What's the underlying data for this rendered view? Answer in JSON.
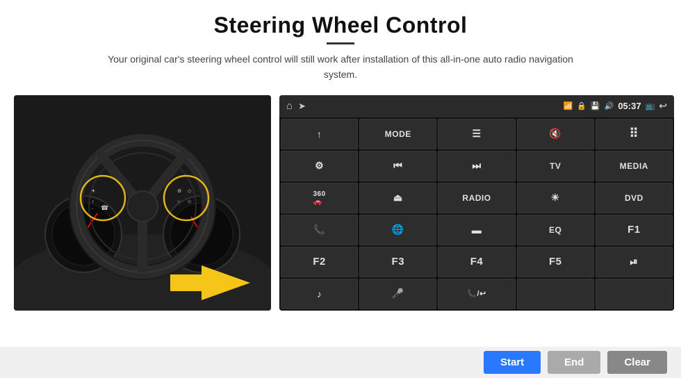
{
  "header": {
    "title": "Steering Wheel Control",
    "subtitle": "Your original car's steering wheel control will still work after installation of this all-in-one auto radio navigation system."
  },
  "android_panel": {
    "status_bar": {
      "time": "05:37",
      "icons": [
        "wifi",
        "lock",
        "sd",
        "bluetooth",
        "cast",
        "back"
      ]
    },
    "grid_buttons": [
      {
        "id": "row1-col1",
        "label": "↑",
        "icon": true
      },
      {
        "id": "row1-col2",
        "label": "MODE",
        "icon": false
      },
      {
        "id": "row1-col3",
        "label": "≡",
        "icon": true
      },
      {
        "id": "row1-col4",
        "label": "🔇",
        "icon": true
      },
      {
        "id": "row1-col5",
        "label": "⊞",
        "icon": true
      },
      {
        "id": "row2-col1",
        "label": "⚙",
        "icon": true
      },
      {
        "id": "row2-col2",
        "label": "⏮",
        "icon": true
      },
      {
        "id": "row2-col3",
        "label": "⏭",
        "icon": true
      },
      {
        "id": "row2-col4",
        "label": "TV",
        "icon": false
      },
      {
        "id": "row2-col5",
        "label": "MEDIA",
        "icon": false
      },
      {
        "id": "row3-col1",
        "label": "360",
        "icon": false
      },
      {
        "id": "row3-col2",
        "label": "⏏",
        "icon": true
      },
      {
        "id": "row3-col3",
        "label": "RADIO",
        "icon": false
      },
      {
        "id": "row3-col4",
        "label": "☀",
        "icon": true
      },
      {
        "id": "row3-col5",
        "label": "DVD",
        "icon": false
      },
      {
        "id": "row4-col1",
        "label": "📞",
        "icon": true
      },
      {
        "id": "row4-col2",
        "label": "🌐",
        "icon": true
      },
      {
        "id": "row4-col3",
        "label": "▬",
        "icon": true
      },
      {
        "id": "row4-col4",
        "label": "EQ",
        "icon": false
      },
      {
        "id": "row4-col5",
        "label": "F1",
        "icon": false
      },
      {
        "id": "row5-col1",
        "label": "F2",
        "icon": false
      },
      {
        "id": "row5-col2",
        "label": "F3",
        "icon": false
      },
      {
        "id": "row5-col3",
        "label": "F4",
        "icon": false
      },
      {
        "id": "row5-col4",
        "label": "F5",
        "icon": false
      },
      {
        "id": "row5-col5",
        "label": "⏯",
        "icon": true
      },
      {
        "id": "row6-col1",
        "label": "♪",
        "icon": true
      },
      {
        "id": "row6-col2",
        "label": "🎤",
        "icon": true
      },
      {
        "id": "row6-col3",
        "label": "📞/↩",
        "icon": true
      },
      {
        "id": "row6-col4",
        "label": "",
        "icon": false
      },
      {
        "id": "row6-col5",
        "label": "",
        "icon": false
      }
    ]
  },
  "bottom_buttons": {
    "start_label": "Start",
    "end_label": "End",
    "clear_label": "Clear"
  },
  "colors": {
    "start_bg": "#2979ff",
    "end_bg": "#aaaaaa",
    "clear_bg": "#888888",
    "panel_bg": "#1c1c1c"
  }
}
